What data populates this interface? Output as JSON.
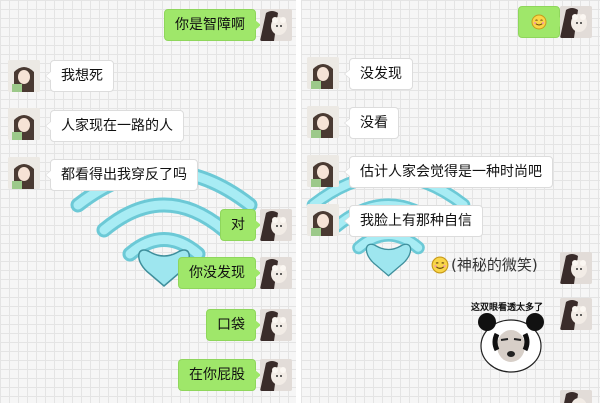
{
  "left_chat": {
    "messages": [
      {
        "side": "out",
        "text": "你是智障啊"
      },
      {
        "side": "in",
        "text": "我想死"
      },
      {
        "side": "in",
        "text": "人家现在一路的人"
      },
      {
        "side": "in",
        "text": "都看得出我穿反了吗"
      },
      {
        "side": "out",
        "text": "对"
      },
      {
        "side": "out",
        "text": "你没发现"
      },
      {
        "side": "out",
        "text": "口袋"
      },
      {
        "side": "out",
        "text": "在你屁股"
      }
    ]
  },
  "right_chat": {
    "messages": [
      {
        "side": "out",
        "emoji": "smile-emoji"
      },
      {
        "side": "in",
        "text": "没发现"
      },
      {
        "side": "in",
        "text": "没看"
      },
      {
        "side": "in",
        "text": "估计人家会觉得是一种时尚吧"
      },
      {
        "side": "in",
        "text": "我脸上有那种自信"
      }
    ],
    "smile_label": "(神秘的微笑)",
    "sticker_caption": "这双眼看透太多了"
  },
  "colors": {
    "outgoing_bubble": "#9fe76a",
    "incoming_bubble": "#ffffff",
    "wifi_decoration": "#86dbe8",
    "grid_background": "#f6f6f6"
  }
}
